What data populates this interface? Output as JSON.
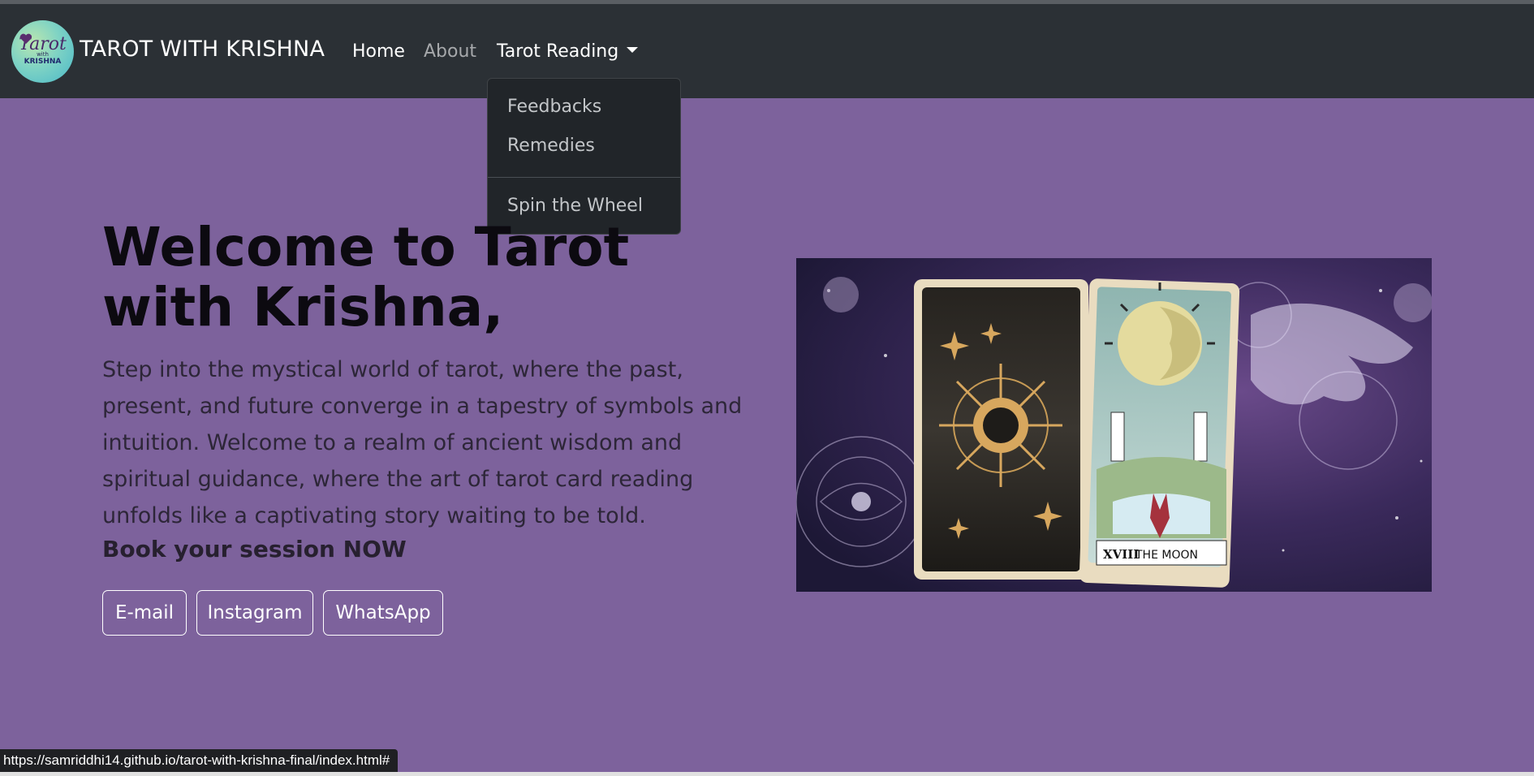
{
  "navbar": {
    "logo": {
      "text_top": "Tarot",
      "text_mid": "with",
      "text_bottom": "KRISHNA"
    },
    "brand": "TAROT WITH KRISHNA",
    "links": {
      "home": "Home",
      "about": "About",
      "tarot_reading": "Tarot Reading"
    }
  },
  "dropdown": {
    "items": [
      "Feedbacks",
      "Remedies",
      "Spin the Wheel"
    ]
  },
  "hero": {
    "title": "Welcome to Tarot with Krishna,",
    "body": "Step into the mystical world of tarot, where the past, present, and future converge in a tapestry of symbols and intuition. Welcome to a realm of ancient wisdom and spiritual guidance, where the art of tarot card reading unfolds like a captivating story waiting to be told.",
    "cta": "Book your session NOW",
    "buttons": {
      "email": "E-mail",
      "instagram": "Instagram",
      "whatsapp": "WhatsApp"
    },
    "image": {
      "card_number": "XVIII",
      "card_name": "THE MOON"
    }
  },
  "status_bar": {
    "url": "https://samriddhi14.github.io/tarot-with-krishna-final/index.html#"
  },
  "colors": {
    "page_bg": "#7d629c",
    "navbar_bg": "#2b3035",
    "dropdown_bg": "#212529"
  }
}
